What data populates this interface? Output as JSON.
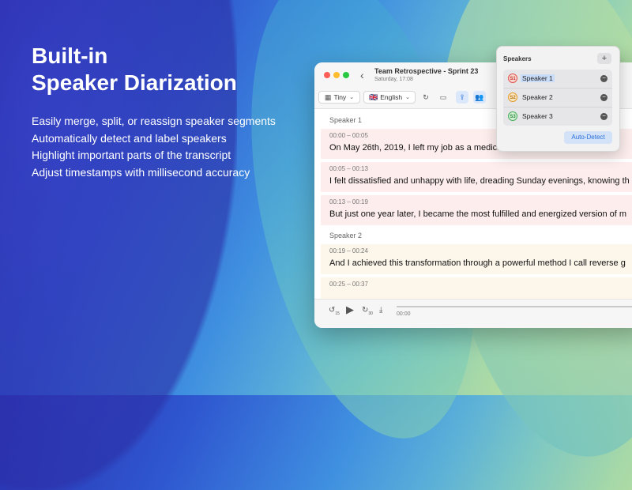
{
  "hero": {
    "title_line1": "Built-in",
    "title_line2": "Speaker Diarization",
    "features": [
      "Easily merge, split, or reassign speaker segments",
      "Automatically detect and label  speakers",
      "Highlight important parts of the transcript",
      "Adjust timestamps with millisecond accuracy"
    ]
  },
  "window": {
    "title": "Team Retrospective - Sprint 23",
    "subtitle": "Saturday, 17:08"
  },
  "toolbar": {
    "model_label": "Tiny",
    "language_flag": "🇬🇧",
    "language_label": "English"
  },
  "transcript": {
    "speaker1_label": "Speaker 1",
    "speaker2_label": "Speaker 2",
    "segments": [
      {
        "time": "00:00 – 00:05",
        "text": "On May 26th, 2019, I left my job as a medical doctor."
      },
      {
        "time": "00:05 – 00:13",
        "text": "I felt dissatisfied and unhappy with life, dreading Sunday evenings, knowing th"
      },
      {
        "time": "00:13 – 00:19",
        "text": "But just one year later, I became the most fulfilled and energized version of m"
      },
      {
        "time": "00:19 – 00:24",
        "text": "And I achieved this transformation through a powerful method I call reverse g"
      },
      {
        "time": "00:25 – 00:37",
        "text": ""
      }
    ]
  },
  "player": {
    "current_time": "00:00",
    "progress": 0,
    "skip_back_label": "15",
    "skip_fwd_label": "30"
  },
  "speakers_popover": {
    "title": "Speakers",
    "add_label": "+",
    "speakers": [
      {
        "badge": "S1",
        "name": "Speaker 1",
        "color": "#e0554e"
      },
      {
        "badge": "S2",
        "name": "Speaker 2",
        "color": "#e39a2a"
      },
      {
        "badge": "S3",
        "name": "Speaker 3",
        "color": "#45b05a"
      }
    ],
    "auto_detect_label": "Auto-Detect"
  }
}
